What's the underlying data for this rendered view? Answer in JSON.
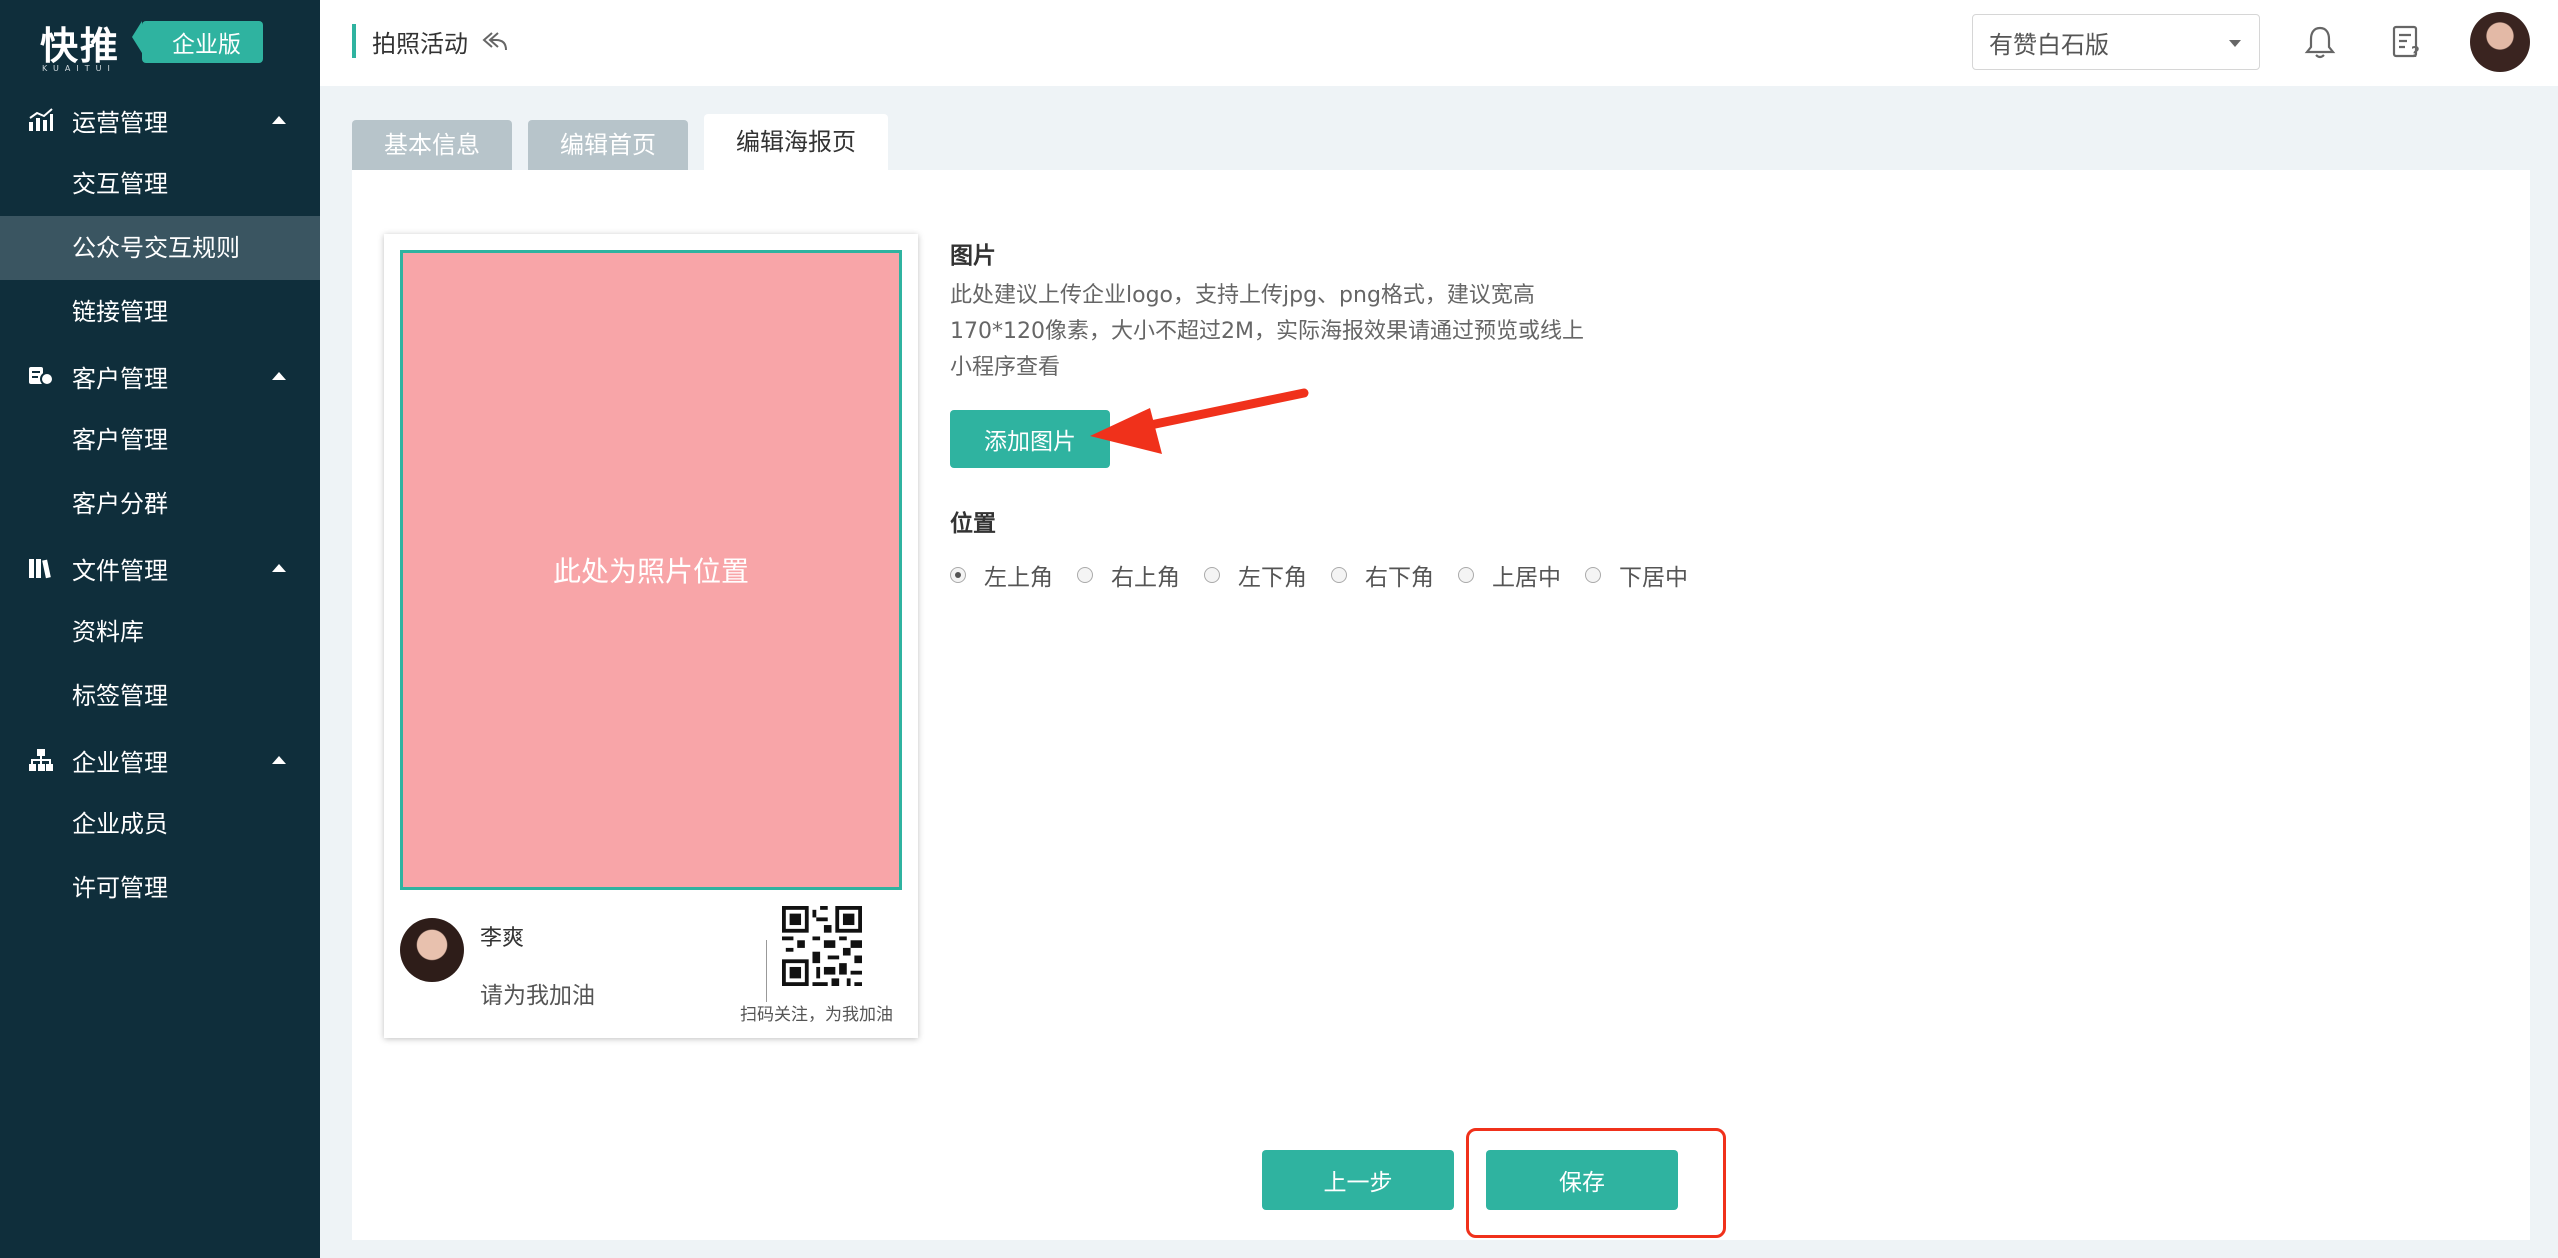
{
  "app": {
    "logo": "快推",
    "logo_sub": "KUAITUI",
    "edition": "企业版"
  },
  "sidebar": {
    "groups": [
      {
        "label": "运营管理",
        "icon": "chart-icon",
        "items": [
          "交互管理",
          "公众号交互规则",
          "链接管理"
        ]
      },
      {
        "label": "客户管理",
        "icon": "customer-icon",
        "items": [
          "客户管理",
          "客户分群"
        ]
      },
      {
        "label": "文件管理",
        "icon": "books-icon",
        "items": [
          "资料库",
          "标签管理"
        ]
      },
      {
        "label": "企业管理",
        "icon": "org-chart-icon",
        "items": [
          "企业成员",
          "许可管理"
        ]
      }
    ],
    "active_item": "公众号交互规则"
  },
  "header": {
    "breadcrumb": "拍照活动",
    "shop_select": "有赞白石版"
  },
  "tabs": [
    "基本信息",
    "编辑首页",
    "编辑海报页"
  ],
  "active_tab": "编辑海报页",
  "poster": {
    "photo_placeholder": "此处为照片位置",
    "user_name": "李爽",
    "slogan": "请为我加油",
    "qr_caption": "扫码关注，为我加油"
  },
  "form": {
    "image_label": "图片",
    "image_desc": "此处建议上传企业logo，支持上传jpg、png格式，建议宽高170*120像素，大小不超过2M，实际海报效果请通过预览或线上小程序查看",
    "add_image_button": "添加图片",
    "position_label": "位置",
    "positions": [
      "左上角",
      "右上角",
      "左下角",
      "右下角",
      "上居中",
      "下居中"
    ],
    "selected_position": "左上角"
  },
  "footer": {
    "prev_button": "上一步",
    "save_button": "保存"
  },
  "colors": {
    "sidebar_bg": "#0f2e3b",
    "accent": "#2fb3a0",
    "photo_bg": "#f8a5a8",
    "annotation": "#f0311b"
  }
}
